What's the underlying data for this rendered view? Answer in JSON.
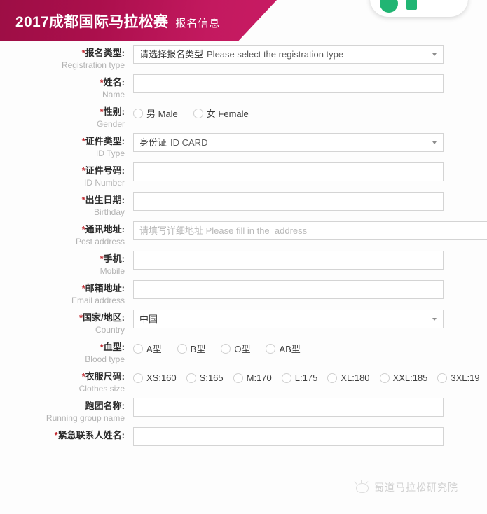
{
  "banner": {
    "title": "2017成都国际马拉松赛",
    "subtitle": "报名信息",
    "color_start": "#9d0e45",
    "color_end": "#c81b63"
  },
  "wechat_pill": {
    "circle_color": "#21b573",
    "square_color": "#21b573"
  },
  "form": {
    "rows": [
      {
        "label_cn": "报名类型:",
        "label_en": "Registration type",
        "required": true,
        "type": "select",
        "value_cn": "请选择报名类型",
        "value_en": "Please select the registration type"
      },
      {
        "label_cn": "姓名:",
        "label_en": "Name",
        "required": true,
        "type": "text",
        "value": ""
      },
      {
        "label_cn": "性别:",
        "label_en": "Gender",
        "required": true,
        "type": "radio",
        "options": [
          "男 Male",
          "女 Female"
        ]
      },
      {
        "label_cn": "证件类型:",
        "label_en": "ID Type",
        "required": true,
        "type": "select",
        "value_cn": "身份证",
        "value_en": "ID CARD"
      },
      {
        "label_cn": "证件号码:",
        "label_en": "ID Number",
        "required": true,
        "type": "text",
        "value": ""
      },
      {
        "label_cn": "出生日期:",
        "label_en": "Birthday",
        "required": true,
        "type": "text",
        "value": ""
      },
      {
        "label_cn": "通讯地址:",
        "label_en": "Post address",
        "required": true,
        "type": "text-wide",
        "value": "",
        "placeholder_cn": "请填写详细地址",
        "placeholder_en": "Please fill in the  address"
      },
      {
        "label_cn": "手机:",
        "label_en": "Mobile",
        "required": true,
        "type": "text",
        "value": ""
      },
      {
        "label_cn": "邮箱地址:",
        "label_en": "Email address",
        "required": true,
        "type": "text",
        "value": ""
      },
      {
        "label_cn": "国家/地区:",
        "label_en": "Country",
        "required": true,
        "type": "select",
        "value_cn": "中国",
        "value_en": ""
      },
      {
        "label_cn": "血型:",
        "label_en": "Blood type",
        "required": true,
        "type": "radio",
        "options": [
          "A型",
          "B型",
          "O型",
          "AB型"
        ]
      },
      {
        "label_cn": "衣服尺码:",
        "label_en": "Clothes size",
        "required": true,
        "type": "radio",
        "options": [
          "XS:160",
          "S:165",
          "M:170",
          "L:175",
          "XL:180",
          "XXL:185",
          "3XL:19"
        ]
      },
      {
        "label_cn": "跑团名称:",
        "label_en": "Running group name",
        "required": false,
        "type": "text",
        "value": ""
      },
      {
        "label_cn": "紧急联系人姓名:",
        "label_en": "",
        "required": true,
        "type": "text",
        "value": ""
      }
    ]
  },
  "watermark": {
    "text": "蜀道马拉松研究院"
  }
}
